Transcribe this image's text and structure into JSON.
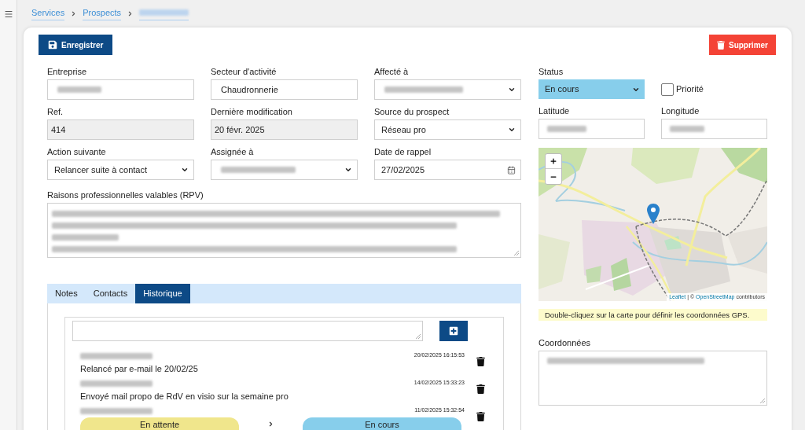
{
  "breadcrumb": {
    "links": [
      "Services",
      "Prospects"
    ],
    "current_redacted": true
  },
  "actions": {
    "save": "Enregistrer",
    "delete": "Supprimer"
  },
  "fields": [
    {
      "label": "Entreprise",
      "kind": "text",
      "redacted": true
    },
    {
      "label": "Secteur d'activité",
      "kind": "text",
      "value": "Chaudronnerie"
    },
    {
      "label": "Affecté à",
      "kind": "select",
      "redacted": true
    },
    {
      "label": "Ref.",
      "kind": "readonly",
      "value": "414"
    },
    {
      "label": "Dernière modification",
      "kind": "readonly",
      "value": "20 févr. 2025"
    },
    {
      "label": "Source du prospect",
      "kind": "select",
      "value": "Réseau pro"
    },
    {
      "label": "Action suivante",
      "kind": "select",
      "value": "Relancer suite à contact"
    },
    {
      "label": "Assignée à",
      "kind": "select",
      "redacted": true
    },
    {
      "label": "Date de rappel",
      "kind": "date",
      "value": "27/02/2025"
    }
  ],
  "rpv": {
    "label": "Raisons professionnelles valables (RPV)",
    "redacted": true
  },
  "tabs": [
    {
      "label": "Notes",
      "selected": false
    },
    {
      "label": "Contacts",
      "selected": false
    },
    {
      "label": "Historique",
      "selected": true
    }
  ],
  "history": {
    "entries": [
      {
        "kind": "note",
        "author_redacted": true,
        "date": "20/02/2025 16:15:53",
        "text": "Relancé par e-mail le 20/02/25"
      },
      {
        "kind": "note",
        "author_redacted": true,
        "date": "14/02/2025 15:33:23",
        "text": "Envoyé mail propo de RdV en visio sur la semaine pro"
      },
      {
        "kind": "status_change",
        "author_redacted": true,
        "date": "11/02/2025 15:32:54",
        "from": {
          "label": "En attente",
          "color": "#f0e68c"
        },
        "to": {
          "label": "En cours",
          "color": "#87ceeb"
        }
      }
    ]
  },
  "status": {
    "label": "Status",
    "value": "En cours"
  },
  "priority": {
    "label": "Priorité",
    "checked": false
  },
  "coordinates": [
    {
      "label": "Latitude",
      "redacted": true
    },
    {
      "label": "Longitude",
      "redacted": true
    }
  ],
  "map": {
    "attribution": {
      "leaflet": "Leaflet",
      "middle": "| ©",
      "osm": "OpenStreetMap",
      "suffix": "contributors"
    }
  },
  "map_hint": "Double-cliquez sur la carte pour définir les coordonnées GPS.",
  "address": {
    "label": "Coordonnées",
    "redacted": true
  }
}
